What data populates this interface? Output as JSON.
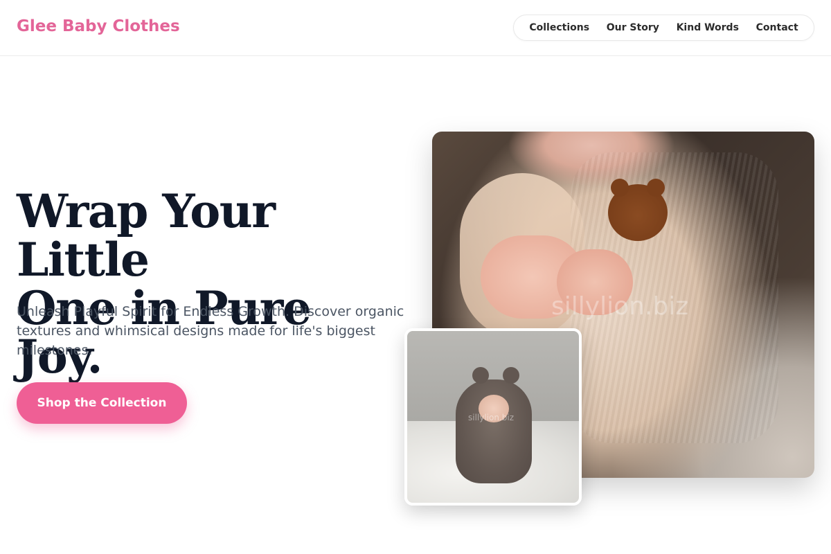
{
  "header": {
    "brand": "Glee Baby Clothes",
    "nav": [
      {
        "label": "Collections"
      },
      {
        "label": "Our Story"
      },
      {
        "label": "Kind Words"
      },
      {
        "label": "Contact"
      }
    ]
  },
  "hero": {
    "title_line1": "Wrap Your Little",
    "title_line2": "One in Pure Joy.",
    "subtitle": "Unleash Playful Spirit for Endless Growth. Discover organic textures and whimsical designs made for life's biggest milestones.",
    "cta_label": "Shop the Collection"
  },
  "images": {
    "main_watermark": "sillylion.biz",
    "small_watermark": "sillylion.biz"
  },
  "colors": {
    "brand": "#e36598",
    "cta": "#ef5f95",
    "title": "#101828",
    "body_text": "#4b5563"
  }
}
